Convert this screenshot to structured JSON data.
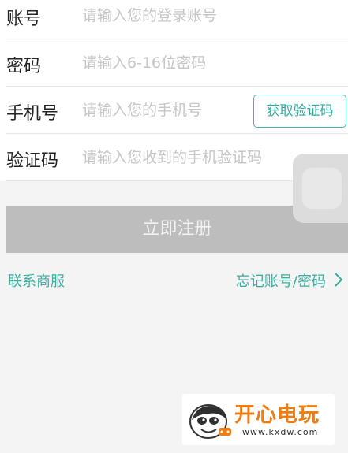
{
  "form": {
    "account": {
      "label": "账号",
      "placeholder": "请输入您的登录账号",
      "value": ""
    },
    "password": {
      "label": "密码",
      "placeholder": "请输入6-16位密码",
      "value": ""
    },
    "phone": {
      "label": "手机号",
      "placeholder": "请输入您的手机号",
      "value": "",
      "get_code_label": "获取验证码"
    },
    "code": {
      "label": "验证码",
      "placeholder": "请输入您收到的手机验证码",
      "value": ""
    }
  },
  "actions": {
    "submit_label": "立即注册",
    "contact_label": "联系商服",
    "forgot_label": "忘记账号/密码",
    "forgot_icon": "chevron-right-icon"
  },
  "floating_button": {
    "icon": "assistive-touch-icon"
  },
  "watermark": {
    "title": "开心电玩",
    "url": "www.kxdw.com",
    "icon": "mascot-logo-icon"
  },
  "colors": {
    "accent": "#3aaea1",
    "submit_bg": "#bdbdbd",
    "page_bg": "#f4f4f4",
    "watermark_title": "#f07d12"
  }
}
